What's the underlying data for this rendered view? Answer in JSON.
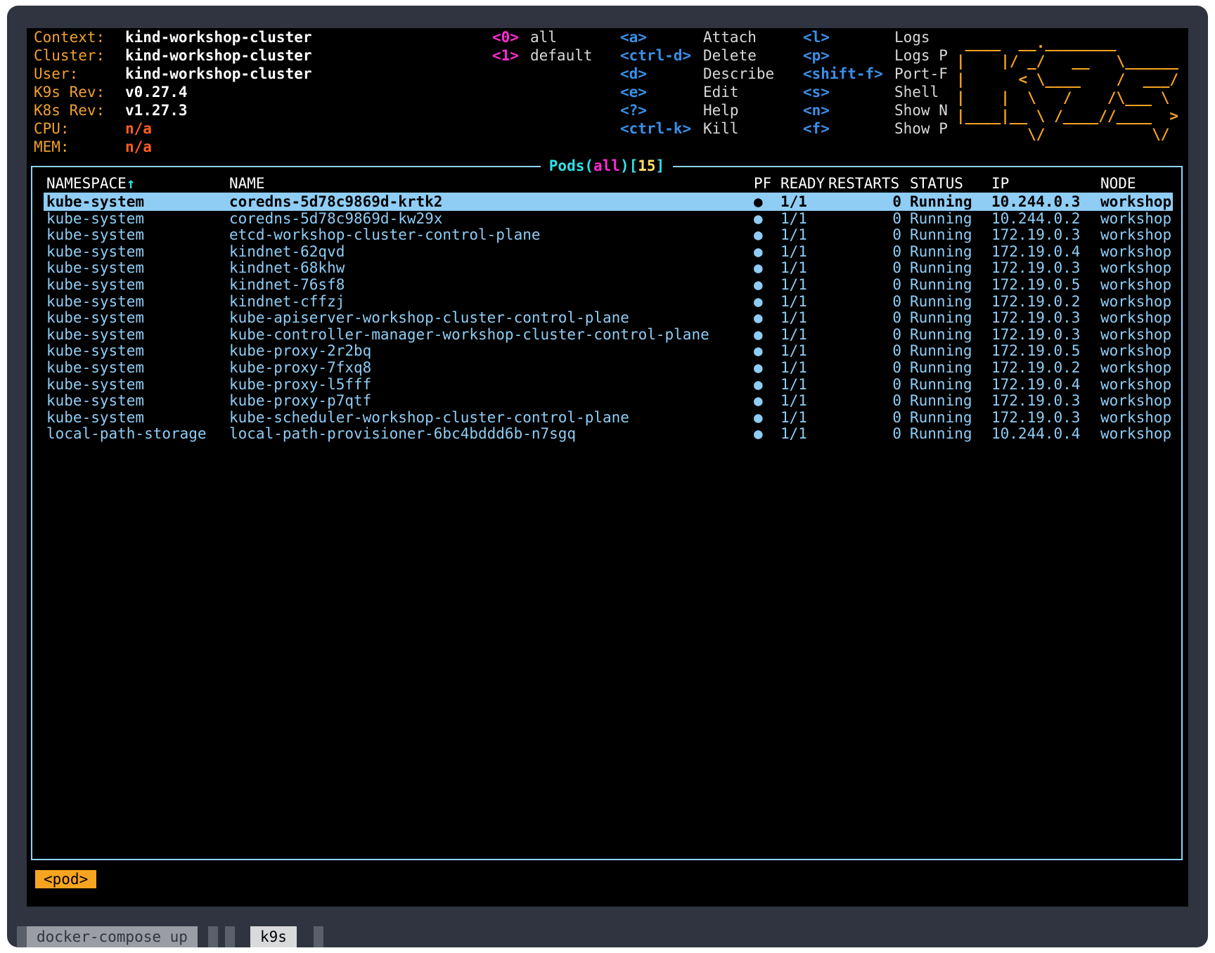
{
  "header": {
    "info": [
      {
        "label": "Context:",
        "value": "kind-workshop-cluster"
      },
      {
        "label": "Cluster:",
        "value": "kind-workshop-cluster"
      },
      {
        "label": "User:",
        "value": "kind-workshop-cluster"
      },
      {
        "label": "K9s Rev:",
        "value": "v0.27.4"
      },
      {
        "label": "K8s Rev:",
        "value": "v1.27.3"
      },
      {
        "label": "CPU:",
        "value": "n/a"
      },
      {
        "label": "MEM:",
        "value": "n/a"
      }
    ],
    "namespaces": [
      {
        "key": "<0>",
        "label": "all"
      },
      {
        "key": "<1>",
        "label": "default"
      }
    ],
    "shortcuts_col1": [
      {
        "key": "<a>",
        "label": "Attach"
      },
      {
        "key": "<ctrl-d>",
        "label": "Delete"
      },
      {
        "key": "<d>",
        "label": "Describe"
      },
      {
        "key": "<e>",
        "label": "Edit"
      },
      {
        "key": "<?>",
        "label": "Help"
      },
      {
        "key": "<ctrl-k>",
        "label": "Kill"
      }
    ],
    "shortcuts_col2": [
      {
        "key": "<l>",
        "label": "Logs"
      },
      {
        "key": "<p>",
        "label": "Logs P"
      },
      {
        "key": "<shift-f>",
        "label": "Port-F"
      },
      {
        "key": "<s>",
        "label": "Shell"
      },
      {
        "key": "<n>",
        "label": "Show N"
      },
      {
        "key": "<f>",
        "label": "Show P"
      }
    ],
    "logo_art": " ____  __.________\n|    |/ _/   __   \\______\n|      < \\____    /  ___/\n|    |  \\   /    /\\___ \\\n|____|__ \\ /____//____  >\n        \\/            \\/"
  },
  "pods_view": {
    "title_resource": "Pods",
    "title_scope": "all",
    "title_count": "15",
    "columns": {
      "namespace": "NAMESPACE",
      "sort_indicator": "↑",
      "name": "NAME",
      "pf": "PF",
      "ready": "READY",
      "restarts": "RESTARTS",
      "status": "STATUS",
      "ip": "IP",
      "node": "NODE"
    },
    "rows": [
      {
        "namespace": "kube-system",
        "name": "coredns-5d78c9869d-krtk2",
        "pf": "●",
        "ready": "1/1",
        "restarts": "0",
        "status": "Running",
        "ip": "10.244.0.3",
        "node": "workshop"
      },
      {
        "namespace": "kube-system",
        "name": "coredns-5d78c9869d-kw29x",
        "pf": "●",
        "ready": "1/1",
        "restarts": "0",
        "status": "Running",
        "ip": "10.244.0.2",
        "node": "workshop"
      },
      {
        "namespace": "kube-system",
        "name": "etcd-workshop-cluster-control-plane",
        "pf": "●",
        "ready": "1/1",
        "restarts": "0",
        "status": "Running",
        "ip": "172.19.0.3",
        "node": "workshop"
      },
      {
        "namespace": "kube-system",
        "name": "kindnet-62qvd",
        "pf": "●",
        "ready": "1/1",
        "restarts": "0",
        "status": "Running",
        "ip": "172.19.0.4",
        "node": "workshop"
      },
      {
        "namespace": "kube-system",
        "name": "kindnet-68khw",
        "pf": "●",
        "ready": "1/1",
        "restarts": "0",
        "status": "Running",
        "ip": "172.19.0.3",
        "node": "workshop"
      },
      {
        "namespace": "kube-system",
        "name": "kindnet-76sf8",
        "pf": "●",
        "ready": "1/1",
        "restarts": "0",
        "status": "Running",
        "ip": "172.19.0.5",
        "node": "workshop"
      },
      {
        "namespace": "kube-system",
        "name": "kindnet-cffzj",
        "pf": "●",
        "ready": "1/1",
        "restarts": "0",
        "status": "Running",
        "ip": "172.19.0.2",
        "node": "workshop"
      },
      {
        "namespace": "kube-system",
        "name": "kube-apiserver-workshop-cluster-control-plane",
        "pf": "●",
        "ready": "1/1",
        "restarts": "0",
        "status": "Running",
        "ip": "172.19.0.3",
        "node": "workshop"
      },
      {
        "namespace": "kube-system",
        "name": "kube-controller-manager-workshop-cluster-control-plane",
        "pf": "●",
        "ready": "1/1",
        "restarts": "0",
        "status": "Running",
        "ip": "172.19.0.3",
        "node": "workshop"
      },
      {
        "namespace": "kube-system",
        "name": "kube-proxy-2r2bq",
        "pf": "●",
        "ready": "1/1",
        "restarts": "0",
        "status": "Running",
        "ip": "172.19.0.5",
        "node": "workshop"
      },
      {
        "namespace": "kube-system",
        "name": "kube-proxy-7fxq8",
        "pf": "●",
        "ready": "1/1",
        "restarts": "0",
        "status": "Running",
        "ip": "172.19.0.2",
        "node": "workshop"
      },
      {
        "namespace": "kube-system",
        "name": "kube-proxy-l5fff",
        "pf": "●",
        "ready": "1/1",
        "restarts": "0",
        "status": "Running",
        "ip": "172.19.0.4",
        "node": "workshop"
      },
      {
        "namespace": "kube-system",
        "name": "kube-proxy-p7qtf",
        "pf": "●",
        "ready": "1/1",
        "restarts": "0",
        "status": "Running",
        "ip": "172.19.0.3",
        "node": "workshop"
      },
      {
        "namespace": "kube-system",
        "name": "kube-scheduler-workshop-cluster-control-plane",
        "pf": "●",
        "ready": "1/1",
        "restarts": "0",
        "status": "Running",
        "ip": "172.19.0.3",
        "node": "workshop"
      },
      {
        "namespace": "local-path-storage",
        "name": "local-path-provisioner-6bc4bddd6b-n7sgq",
        "pf": "●",
        "ready": "1/1",
        "restarts": "0",
        "status": "Running",
        "ip": "10.244.0.4",
        "node": "workshop"
      }
    ],
    "selected_row": 0
  },
  "breadcrumb": "<pod>",
  "tabs": [
    "docker-compose up",
    "k9s"
  ],
  "colors": {
    "accent_orange": "#f7a420",
    "row_text": "#8fcdf5",
    "frame_border": "#8fd3ff",
    "shortcut_key": "#3a8fe8",
    "namespace_key": "#ff2ad4"
  }
}
